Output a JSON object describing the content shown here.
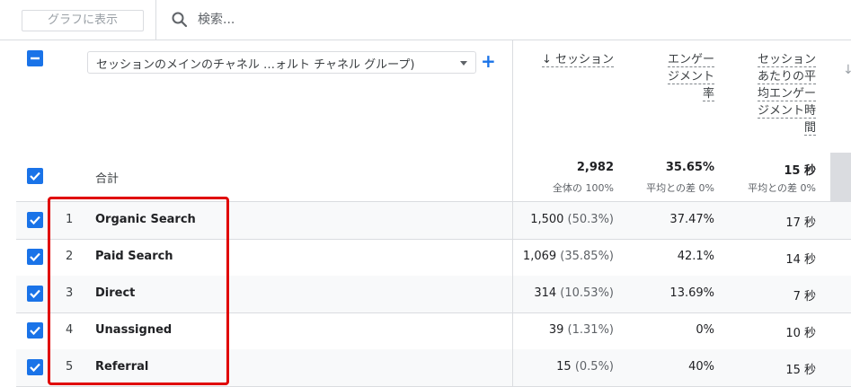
{
  "toolbar": {
    "graph_button": "グラフに表示",
    "search_placeholder": "検索..."
  },
  "dimension": {
    "label": "セッションのメインのチャネル …ォルト チャネル グループ)",
    "add_symbol": "+"
  },
  "columns": {
    "sessions": "↓ セッション",
    "engagement_rate": [
      "エンゲー",
      "ジメント",
      "率"
    ],
    "avg_engagement_time": [
      "セッション",
      "あたりの平",
      "均エンゲー",
      "ジメント時",
      "間"
    ]
  },
  "totals": {
    "label": "合計",
    "sessions": "2,982",
    "sessions_sub": "全体の 100%",
    "engagement_rate": "35.65%",
    "engagement_rate_sub": "平均との差 0%",
    "avg_time": "15 秒",
    "avg_time_sub": "平均との差 0%"
  },
  "rows": [
    {
      "num": "1",
      "channel": "Organic Search",
      "sessions": "1,500",
      "sessions_pct": "(50.3%)",
      "engagement_rate": "37.47%",
      "avg_time": "17 秒"
    },
    {
      "num": "2",
      "channel": "Paid Search",
      "sessions": "1,069",
      "sessions_pct": "(35.85%)",
      "engagement_rate": "42.1%",
      "avg_time": "14 秒"
    },
    {
      "num": "3",
      "channel": "Direct",
      "sessions": "314",
      "sessions_pct": "(10.53%)",
      "engagement_rate": "13.69%",
      "avg_time": "7 秒"
    },
    {
      "num": "4",
      "channel": "Unassigned",
      "sessions": "39",
      "sessions_pct": "(1.31%)",
      "engagement_rate": "0%",
      "avg_time": "10 秒"
    },
    {
      "num": "5",
      "channel": "Referral",
      "sessions": "15",
      "sessions_pct": "(0.5%)",
      "engagement_rate": "40%",
      "avg_time": "15 秒"
    }
  ],
  "colors": {
    "accent": "#1a73e8",
    "highlight": "#e00000"
  }
}
